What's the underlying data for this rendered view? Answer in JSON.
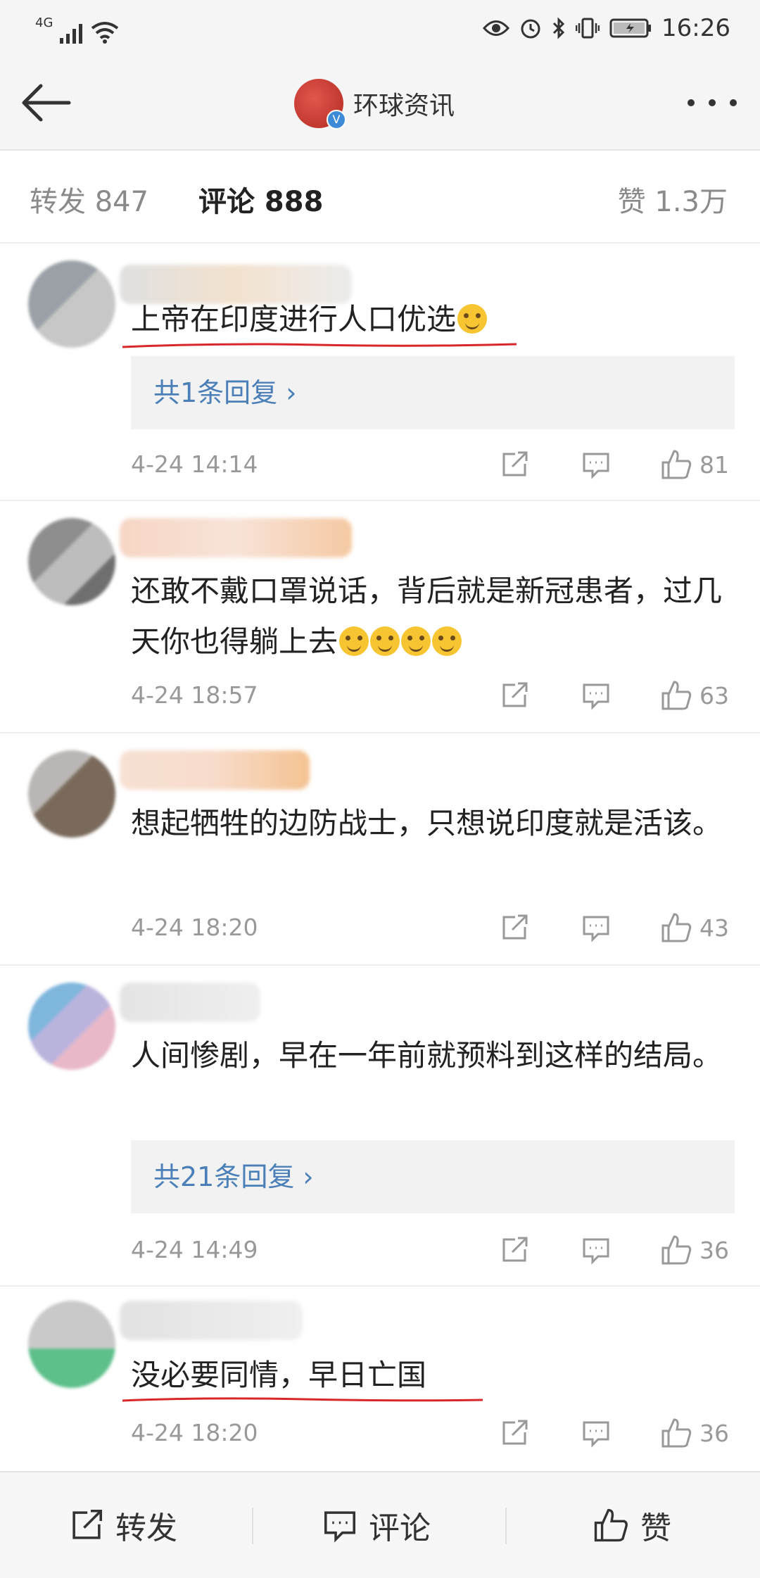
{
  "status_bar": {
    "network": "4G",
    "time": "16:26",
    "icons": [
      "signal-icon",
      "wifi-icon",
      "eye-icon",
      "alarm-icon",
      "bluetooth-icon",
      "vibrate-icon",
      "battery-icon"
    ]
  },
  "header": {
    "title": "环球资讯",
    "verified": "V"
  },
  "tabs": {
    "forward": "转发 847",
    "comments": "评论 888",
    "likes": "赞 1.3万"
  },
  "comments": [
    {
      "text": "上帝在印度进行人口优选",
      "emoji_count": 1,
      "replies": "共1条回复 ›",
      "time": "4-24 14:14",
      "likes": "81"
    },
    {
      "text": "还敢不戴口罩说话，背后就是新冠患者，过几天你也得躺上去",
      "emoji_count": 4,
      "replies": "",
      "time": "4-24 18:57",
      "likes": "63"
    },
    {
      "text": "想起牺牲的边防战士，只想说印度就是活该。",
      "emoji_count": 0,
      "replies": "",
      "time": "4-24 18:20",
      "likes": "43"
    },
    {
      "text": "人间惨剧，早在一年前就预料到这样的结局。",
      "emoji_count": 0,
      "replies": "共21条回复 ›",
      "time": "4-24 14:49",
      "likes": "36"
    },
    {
      "text": "没必要同情，早日亡国",
      "emoji_count": 0,
      "replies": "",
      "time": "4-24 18:20",
      "likes": "36"
    }
  ],
  "bottom_bar": {
    "forward": "转发",
    "comment": "评论",
    "like": "赞"
  },
  "colors": {
    "link": "#4a7fb8",
    "underline": "#d9262a",
    "muted": "#999999"
  }
}
